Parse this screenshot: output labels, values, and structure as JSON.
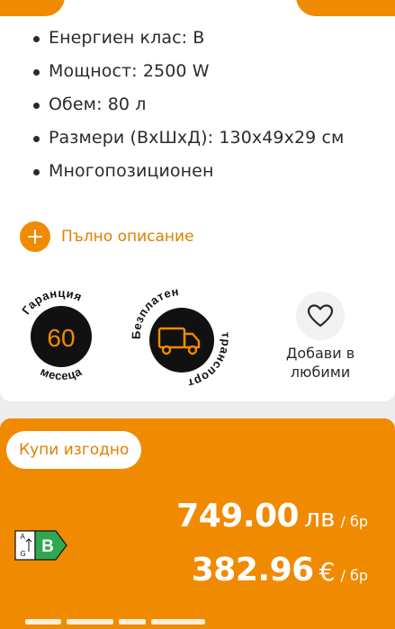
{
  "specs": [
    "Енергиен клас: B",
    "Мощност: 2500 W",
    "Обем: 80 л",
    "Размери (ВхШхД): 130x49x29 см",
    "Многопозиционен"
  ],
  "full_description_label": "Пълно описание",
  "warranty": {
    "top_text": "Гаранция",
    "number": "60",
    "bottom_text": "месеца"
  },
  "shipping": {
    "top_text": "Безплатен",
    "bottom_text": "транспорт"
  },
  "favorites": {
    "line1": "Добави в",
    "line2": "любими"
  },
  "deal_label": "Купи изгодно",
  "energy_label": {
    "class": "B",
    "scale_top": "A",
    "scale_bottom": "G"
  },
  "prices": {
    "bgn": {
      "amount": "749.00",
      "currency": "лв",
      "unit": "/ бр"
    },
    "eur": {
      "amount": "382.96",
      "currency": "€",
      "unit": "/ бр"
    }
  },
  "colors": {
    "accent": "#f08a00",
    "accent_text": "#e07f00",
    "energy_green": "#2fa84f",
    "badge_black": "#111111"
  },
  "icons": [
    "plus-icon",
    "truck-icon",
    "heart-icon",
    "energy-label-icon"
  ]
}
